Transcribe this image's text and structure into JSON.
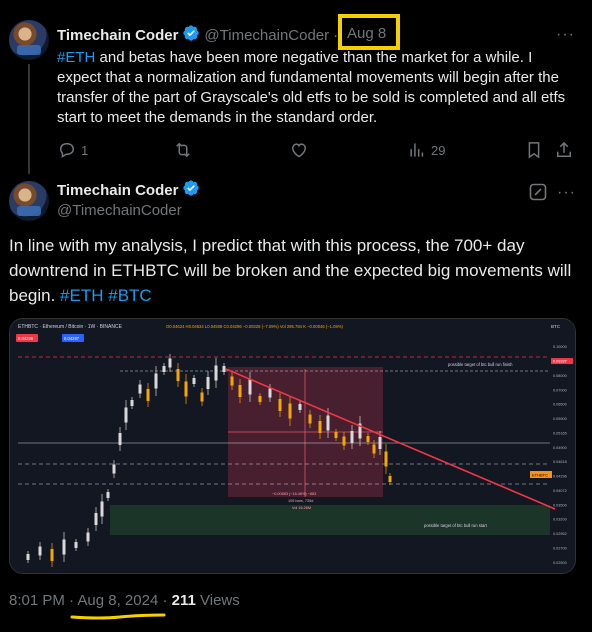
{
  "reply_tweet": {
    "author_name": "Timechain Coder",
    "handle": "@TimechainCoder",
    "separator": "·",
    "date": "Aug 8",
    "text_hashtag": "#ETH",
    "text_body": " and betas have been more negative than the market for a while. I expect that a normalization and fundamental movements will begin after the transfer of the part of Grayscale's old etfs to be sold is completed and all etfs start to meet the demands in the standard order.",
    "actions": {
      "reply_count": "1",
      "retweet_count": "",
      "like_count": "",
      "views_count": "29"
    }
  },
  "main_tweet": {
    "author_name": "Timechain Coder",
    "handle": "@TimechainCoder",
    "text": "In line with my analysis, I predict that with this process, the 700+ day downtrend in ETHBTC will be broken and the expected big movements will begin. ",
    "hashtag_1": "#ETH",
    "hashtag_2": "#BTC",
    "time": "8:01 PM",
    "date": "Aug 8, 2024",
    "separator": "·",
    "views_count": "211",
    "views_label": "Views"
  },
  "chart_image": {
    "header_symbol": "ETHBTC · Ethereum / Bitcoin · 1W · BINANCE",
    "header_ohlc": "O0.04624 H0.04634 L0.04508 C0.04296 −0.00328 (−7.09%)  Vol 295.784 K  −0.00046 (−1.08%)",
    "price_badge_1": "0.04296",
    "price_badge_2": "0.04297",
    "btc_label": "BTC",
    "ethbtc_label": "ETHBTC",
    "annotation_top": "possible target of btc bull run finish",
    "annotation_bottom": "possible target of btc bull run start",
    "measure_text_1": "−0.00883 (−16.46%) −883",
    "measure_text_2": "105 bars, 735d",
    "measure_text_3": "Vol 16.26M",
    "axis_labels": [
      "0.10000",
      "0.09337",
      "0.08000",
      "0.07000",
      "0.06500",
      "0.05900",
      "0.05165",
      "0.04900",
      "0.04618",
      "0.04296",
      "0.04072",
      "0.03500",
      "0.03200",
      "0.02952",
      "0.02700",
      "0.02500"
    ],
    "y_range": [
      0.024,
      0.101
    ],
    "colors": {
      "background": "#131722",
      "up_candle": "#d9d9d9",
      "down_candle": "#f7a600",
      "trendline": "#f23645",
      "measure_box": "#5b2333",
      "target_box": "#1f3b2a",
      "accent_badge": "#f7931a"
    }
  },
  "colors": {
    "background": "#000000",
    "text": "#e7e9ea",
    "muted": "#71767b",
    "link": "#1d9bf0",
    "verified": "#1d9bf0",
    "highlight_box": "#f4d000",
    "underline": "#f4d000"
  }
}
